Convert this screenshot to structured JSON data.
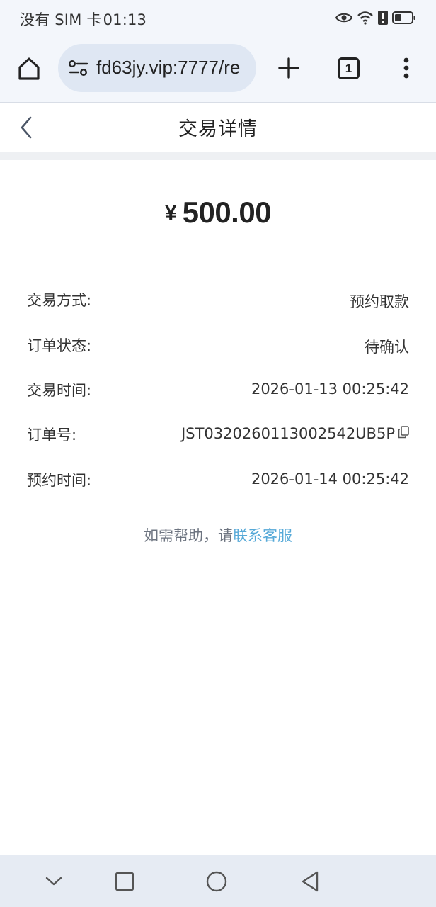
{
  "status_bar": {
    "carrier": "没有 SIM 卡",
    "time": "01:13",
    "icons": [
      "eye-icon",
      "wifi-icon",
      "alert-icon",
      "battery-icon"
    ]
  },
  "browser": {
    "url": "fd63jy.vip:7777/re",
    "tab_count": "1",
    "icons": [
      "home-icon",
      "site-settings-icon",
      "new-tab-icon",
      "tabs-icon",
      "more-menu-icon"
    ]
  },
  "header": {
    "title": "交易详情",
    "back_icon": "chevron-left-icon"
  },
  "amount": {
    "currency": "¥",
    "value": "500.00"
  },
  "details": [
    {
      "label": "交易方式:",
      "value": "预约取款"
    },
    {
      "label": "订单状态:",
      "value": "待确认"
    },
    {
      "label": "交易时间:",
      "value": "2026-01-13 00:25:42"
    },
    {
      "label": "订单号:",
      "value": "JST0320260113002542UB5P",
      "icon": "copy-icon"
    },
    {
      "label": "预约时间:",
      "value": "2026-01-14 00:25:42"
    }
  ],
  "help": {
    "prefix": "如需帮助，请",
    "link": "联系客服"
  },
  "nav_bar": {
    "icons": [
      "chevron-down-icon",
      "recents-square-icon",
      "home-circle-icon",
      "back-triangle-icon"
    ]
  },
  "colors": {
    "link": "#56a9d8",
    "chrome_bg": "#f3f6fb",
    "url_pill": "#dfe7f3",
    "nav_bg": "#e6ebf3"
  }
}
